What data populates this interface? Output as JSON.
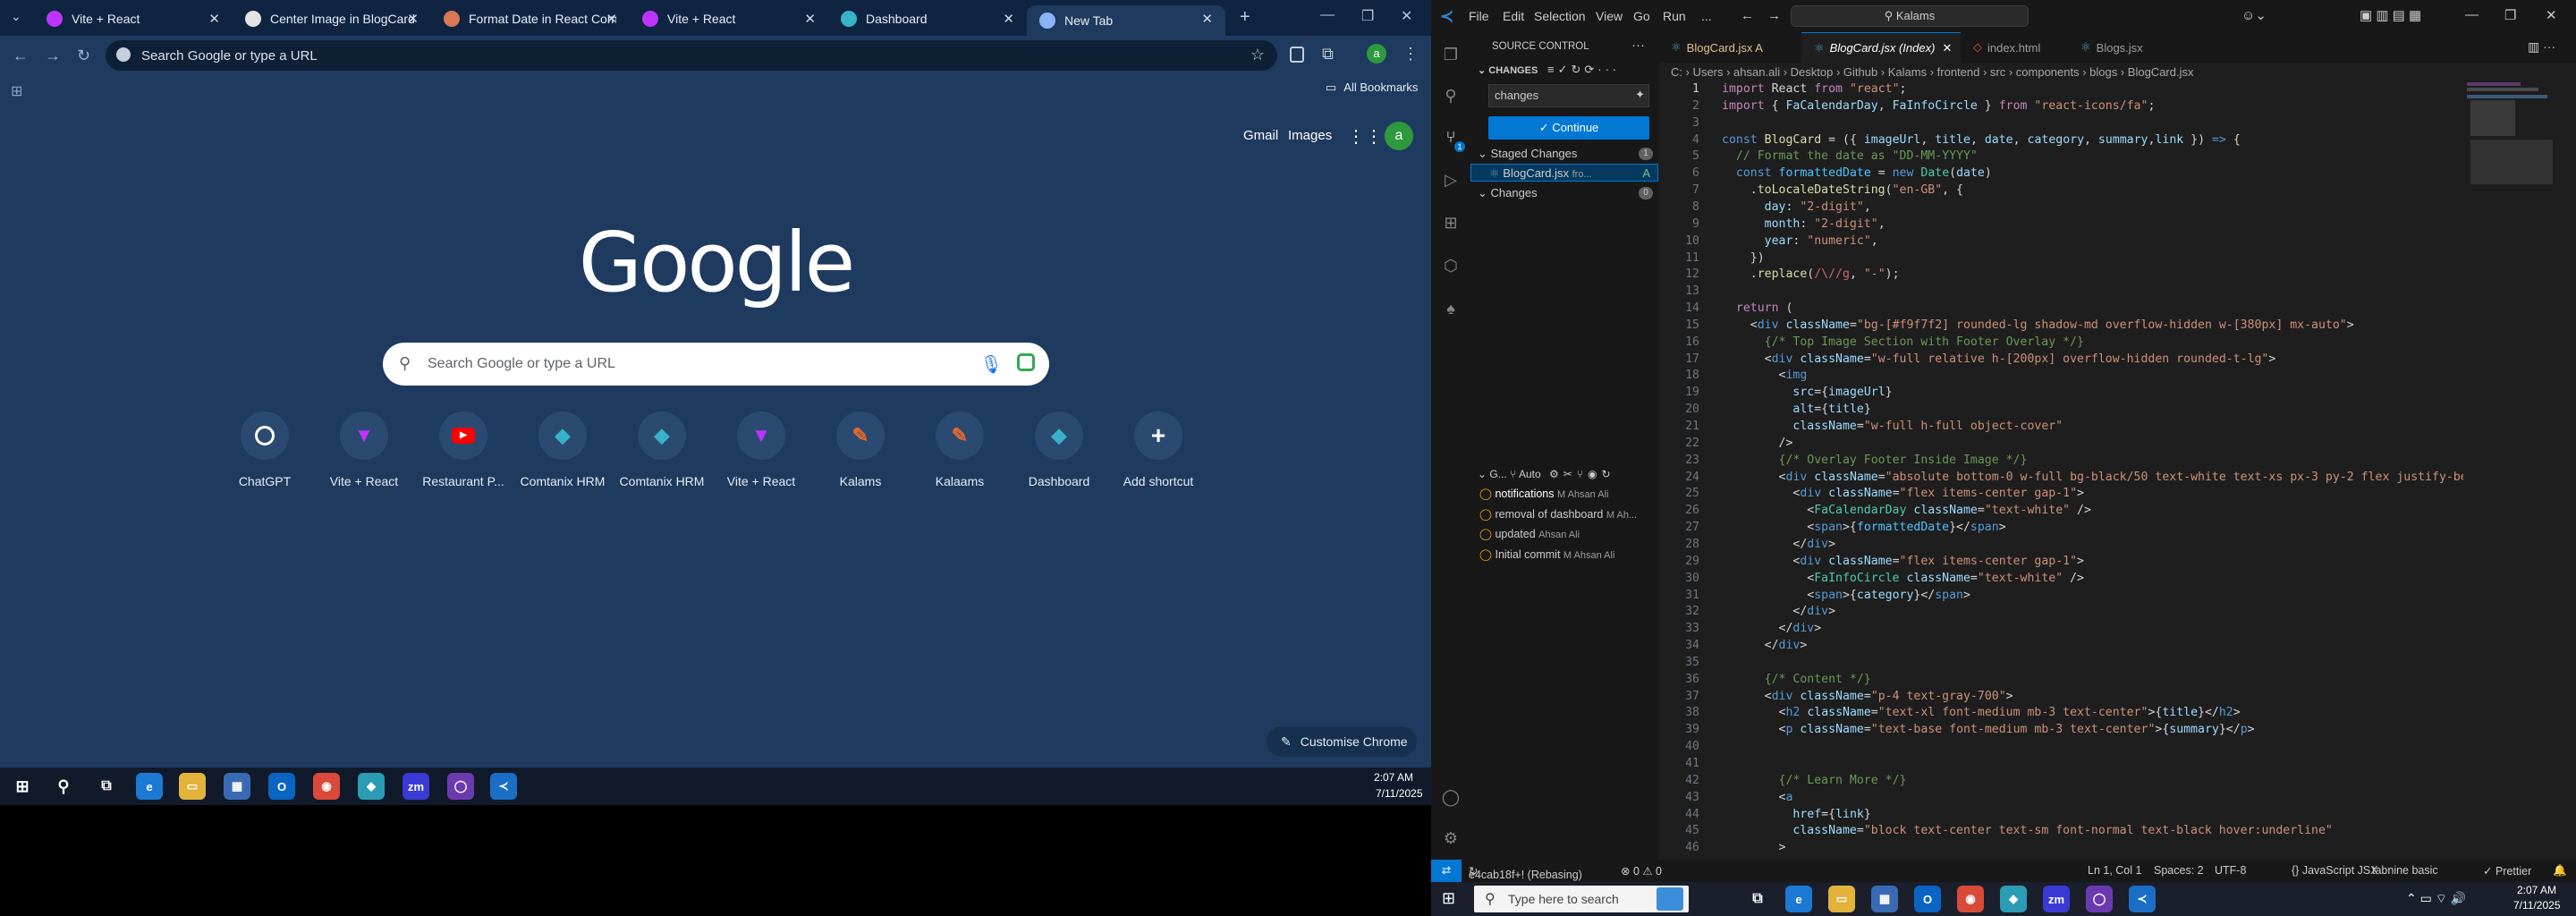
{
  "browser": {
    "tabs": [
      {
        "label": "Vite + React",
        "icon": "vite-icon",
        "active": false
      },
      {
        "label": "Center Image in BlogCard",
        "icon": "chatgpt-icon",
        "active": false
      },
      {
        "label": "Format Date in React Compo",
        "icon": "claude-icon",
        "active": false
      },
      {
        "label": "Vite + React",
        "icon": "vite-icon",
        "active": false
      },
      {
        "label": "Dashboard",
        "icon": "comtanix-icon",
        "active": false
      },
      {
        "label": "New Tab",
        "icon": "chrome-icon",
        "active": true
      }
    ],
    "omnibox_placeholder": "Search Google or type a URL",
    "all_bookmarks": "All Bookmarks",
    "top_links": {
      "gmail": "Gmail",
      "images": "Images",
      "avatar": "a"
    },
    "logo": "Google",
    "search_placeholder": "Search Google or type a URL",
    "shortcuts": [
      {
        "label": "ChatGPT",
        "icon": "chatgpt-icon",
        "color": "#ffffff"
      },
      {
        "label": "Vite + React",
        "icon": "vite-icon",
        "color": "#bd34fe"
      },
      {
        "label": "Restaurant P...",
        "icon": "youtube-icon",
        "color": "#ff0000"
      },
      {
        "label": "Comtanix HRM",
        "icon": "comtanix-icon",
        "color": "#38b2c8"
      },
      {
        "label": "Comtanix HRM",
        "icon": "comtanix-icon",
        "color": "#38b2c8"
      },
      {
        "label": "Vite + React",
        "icon": "vite-icon",
        "color": "#bd34fe"
      },
      {
        "label": "Kalams",
        "icon": "kalams-icon",
        "color": "#e56b2f"
      },
      {
        "label": "Kalaams",
        "icon": "kalams-icon",
        "color": "#e56b2f"
      },
      {
        "label": "Dashboard",
        "icon": "comtanix-icon",
        "color": "#38b2c8"
      },
      {
        "label": "Add shortcut",
        "icon": "plus-icon",
        "color": "#ffffff"
      }
    ],
    "customise": "Customise Chrome",
    "taskbar_time": "2:07 AM",
    "taskbar_date": "7/11/2025"
  },
  "vscode": {
    "menu": [
      "File",
      "Edit",
      "Selection",
      "View",
      "Go",
      "Run",
      "..."
    ],
    "command_center": "Kalams",
    "tabs": [
      {
        "label": "BlogCard.jsx A",
        "active": false
      },
      {
        "label": "BlogCard.jsx (Index)",
        "active": true
      },
      {
        "label": "index.html",
        "active": false
      },
      {
        "label": "Blogs.jsx",
        "active": false
      }
    ],
    "breadcrumb": "C: › Users › ahsan.ali › Desktop › Github › Kalams › frontend › src › components › blogs › BlogCard.jsx",
    "scm": {
      "title": "SOURCE CONTROL",
      "section": "CHANGES",
      "message": "changes",
      "commit_button": "Continue",
      "staged_label": "Staged Changes",
      "staged_count": "1",
      "staged_file": "BlogCard.jsx",
      "staged_file_path": "fro...",
      "staged_file_status": "A",
      "changes_label": "Changes",
      "changes_count": "0",
      "graph_label": "G...",
      "graph_auto": "Auto",
      "commits": [
        {
          "message": "notifications",
          "author": "M Ahsan Ali"
        },
        {
          "message": "removal of dashboard",
          "author": "M Ah..."
        },
        {
          "message": "updated",
          "author": "Ahsan Ali"
        },
        {
          "message": "Initial commit",
          "author": "M Ahsan Ali"
        }
      ]
    },
    "code": [
      {
        "n": "1",
        "html": "<span style='color:#c586c0'>import</span> React <span style='color:#c586c0'>from</span> <span style='color:#ce9178'>\"react\"</span>;"
      },
      {
        "n": "2",
        "html": "<span style='color:#c586c0'>import</span> { <span style='color:#9cdcfe'>FaCalendarDay</span>, <span style='color:#9cdcfe'>FaInfoCircle</span> } <span style='color:#c586c0'>from</span> <span style='color:#ce9178'>\"react-icons/fa\"</span>;"
      },
      {
        "n": "3",
        "html": ""
      },
      {
        "n": "4",
        "html": "<span style='color:#569cd6'>const</span> <span style='color:#dcdcaa'>BlogCard</span> = ({ <span style='color:#9cdcfe'>imageUrl</span>, <span style='color:#9cdcfe'>title</span>, <span style='color:#9cdcfe'>date</span>, <span style='color:#9cdcfe'>category</span>, <span style='color:#9cdcfe'>summary</span>,<span style='color:#9cdcfe'>link</span> }) <span style='color:#569cd6'>=&gt;</span> {"
      },
      {
        "n": "5",
        "html": "  <span style='color:#6a9955'>// Format the date as \"DD-MM-YYYY\"</span>"
      },
      {
        "n": "6",
        "html": "  <span style='color:#569cd6'>const</span> <span style='color:#4fc1ff'>formattedDate</span> = <span style='color:#569cd6'>new</span> <span style='color:#4ec9b0'>Date</span>(<span style='color:#9cdcfe'>date</span>)"
      },
      {
        "n": "7",
        "html": "    .<span style='color:#dcdcaa'>toLocaleDateString</span>(<span style='color:#ce9178'>\"en-GB\"</span>, {"
      },
      {
        "n": "8",
        "html": "      <span style='color:#9cdcfe'>day</span>: <span style='color:#ce9178'>\"2-digit\"</span>,"
      },
      {
        "n": "9",
        "html": "      <span style='color:#9cdcfe'>month</span>: <span style='color:#ce9178'>\"2-digit\"</span>,"
      },
      {
        "n": "10",
        "html": "      <span style='color:#9cdcfe'>year</span>: <span style='color:#ce9178'>\"numeric\"</span>,"
      },
      {
        "n": "11",
        "html": "    })"
      },
      {
        "n": "12",
        "html": "    .<span style='color:#dcdcaa'>replace</span>(<span style='color:#d16969'>/\\//g</span>, <span style='color:#ce9178'>\"-\"</span>);"
      },
      {
        "n": "13",
        "html": ""
      },
      {
        "n": "14",
        "html": "  <span style='color:#c586c0'>return</span> ("
      },
      {
        "n": "15",
        "html": "    &lt;<span style='color:#569cd6'>div</span> <span style='color:#9cdcfe'>className</span>=<span style='color:#ce9178'>\"bg-[#f9f7f2] rounded-lg shadow-md overflow-hidden w-[380px] mx-auto\"</span>&gt;"
      },
      {
        "n": "16",
        "html": "      <span style='color:#6a9955'>{/* Top Image Section with Footer Overlay */}</span>"
      },
      {
        "n": "17",
        "html": "      &lt;<span style='color:#569cd6'>div</span> <span style='color:#9cdcfe'>className</span>=<span style='color:#ce9178'>\"w-full relative h-[200px] overflow-hidden rounded-t-lg\"</span>&gt;"
      },
      {
        "n": "18",
        "html": "        &lt;<span style='color:#569cd6'>img</span>"
      },
      {
        "n": "19",
        "html": "          <span style='color:#9cdcfe'>src</span>={<span style='color:#9cdcfe'>imageUrl</span>}"
      },
      {
        "n": "20",
        "html": "          <span style='color:#9cdcfe'>alt</span>={<span style='color:#9cdcfe'>title</span>}"
      },
      {
        "n": "21",
        "html": "          <span style='color:#9cdcfe'>className</span>=<span style='color:#ce9178'>\"w-full h-full object-cover\"</span>"
      },
      {
        "n": "22",
        "html": "        /&gt;"
      },
      {
        "n": "23",
        "html": "        <span style='color:#6a9955'>{/* Overlay Footer Inside Image */}</span>"
      },
      {
        "n": "24",
        "html": "        &lt;<span style='color:#569cd6'>div</span> <span style='color:#9cdcfe'>className</span>=<span style='color:#ce9178'>\"absolute bottom-0 w-full bg-black/50 text-white text-xs px-3 py-2 flex justify-betw</span>"
      },
      {
        "n": "25",
        "html": "          &lt;<span style='color:#569cd6'>div</span> <span style='color:#9cdcfe'>className</span>=<span style='color:#ce9178'>\"flex items-center gap-1\"</span>&gt;"
      },
      {
        "n": "26",
        "html": "            &lt;<span style='color:#4ec9b0'>FaCalendarDay</span> <span style='color:#9cdcfe'>className</span>=<span style='color:#ce9178'>\"text-white\"</span> /&gt;"
      },
      {
        "n": "27",
        "html": "            &lt;<span style='color:#569cd6'>span</span>&gt;{<span style='color:#4fc1ff'>formattedDate</span>}&lt;/<span style='color:#569cd6'>span</span>&gt;"
      },
      {
        "n": "28",
        "html": "          &lt;/<span style='color:#569cd6'>div</span>&gt;"
      },
      {
        "n": "29",
        "html": "          &lt;<span style='color:#569cd6'>div</span> <span style='color:#9cdcfe'>className</span>=<span style='color:#ce9178'>\"flex items-center gap-1\"</span>&gt;"
      },
      {
        "n": "30",
        "html": "            &lt;<span style='color:#4ec9b0'>FaInfoCircle</span> <span style='color:#9cdcfe'>className</span>=<span style='color:#ce9178'>\"text-white\"</span> /&gt;"
      },
      {
        "n": "31",
        "html": "            &lt;<span style='color:#569cd6'>span</span>&gt;{<span style='color:#9cdcfe'>category</span>}&lt;/<span style='color:#569cd6'>span</span>&gt;"
      },
      {
        "n": "32",
        "html": "          &lt;/<span style='color:#569cd6'>div</span>&gt;"
      },
      {
        "n": "33",
        "html": "        &lt;/<span style='color:#569cd6'>div</span>&gt;"
      },
      {
        "n": "34",
        "html": "      &lt;/<span style='color:#569cd6'>div</span>&gt;"
      },
      {
        "n": "35",
        "html": ""
      },
      {
        "n": "36",
        "html": "      <span style='color:#6a9955'>{/* Content */}</span>"
      },
      {
        "n": "37",
        "html": "      &lt;<span style='color:#569cd6'>div</span> <span style='color:#9cdcfe'>className</span>=<span style='color:#ce9178'>\"p-4 text-gray-700\"</span>&gt;"
      },
      {
        "n": "38",
        "html": "        &lt;<span style='color:#569cd6'>h2</span> <span style='color:#9cdcfe'>className</span>=<span style='color:#ce9178'>\"text-xl font-medium mb-3 text-center\"</span>&gt;{<span style='color:#9cdcfe'>title</span>}&lt;/<span style='color:#569cd6'>h2</span>&gt;"
      },
      {
        "n": "39",
        "html": "        &lt;<span style='color:#569cd6'>p</span> <span style='color:#9cdcfe'>className</span>=<span style='color:#ce9178'>\"text-base font-medium mb-3 text-center\"</span>&gt;{<span style='color:#9cdcfe'>summary</span>}&lt;/<span style='color:#569cd6'>p</span>&gt;"
      },
      {
        "n": "40",
        "html": ""
      },
      {
        "n": "41",
        "html": ""
      },
      {
        "n": "42",
        "html": "        <span style='color:#6a9955'>{/* Learn More */}</span>"
      },
      {
        "n": "43",
        "html": "        &lt;<span style='color:#569cd6'>a</span>"
      },
      {
        "n": "44",
        "html": "          <span style='color:#9cdcfe'>href</span>={<span style='color:#9cdcfe'>link</span>}"
      },
      {
        "n": "45",
        "html": "          <span style='color:#9cdcfe'>className</span>=<span style='color:#ce9178'>\"block text-center text-sm font-normal text-black hover:underline\"</span>"
      },
      {
        "n": "46",
        "html": "        &gt;"
      }
    ],
    "status": {
      "branch": "e4cab18f+! (Rebasing)",
      "errors": "⊗ 0 ⚠ 0",
      "position": "Ln 1, Col 1",
      "spaces": "Spaces: 2",
      "encoding": "UTF-8",
      "language": "{} JavaScript JSX",
      "tabnine": "tabnine basic",
      "prettier": "✓ Prettier"
    }
  },
  "windows_taskbar": {
    "search_placeholder": "Type here to search",
    "time": "2:07 AM",
    "date": "7/11/2025"
  }
}
